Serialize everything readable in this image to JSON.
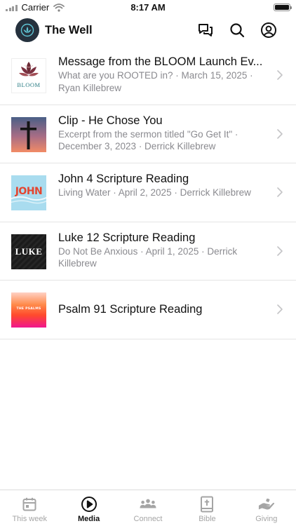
{
  "status_bar": {
    "carrier": "Carrier",
    "time": "8:17 AM"
  },
  "header": {
    "title": "The Well",
    "icons": [
      "chat-icon",
      "search-icon",
      "profile-icon"
    ]
  },
  "media_items": [
    {
      "title": "Message from the BLOOM Launch Ev...",
      "subtitle": "What are you ROOTED in? · March 15, 2025 · Ryan Killebrew",
      "thumb_text": "BLOOM"
    },
    {
      "title": "Clip - He Chose You",
      "subtitle": "Excerpt from the sermon titled \"Go Get It\" · December 3, 2023 · Derrick Killebrew",
      "thumb_text": ""
    },
    {
      "title": "John 4 Scripture Reading",
      "subtitle": "Living Water · April 2, 2025 · Derrick Killebrew",
      "thumb_text": "JOHN"
    },
    {
      "title": "Luke 12 Scripture Reading",
      "subtitle": "Do Not Be Anxious · April 1, 2025 · Derrick Killebrew",
      "thumb_text": "LUKE"
    },
    {
      "title": "Psalm 91 Scripture Reading",
      "subtitle": "",
      "thumb_text": "THE PSALMS"
    }
  ],
  "tabs": [
    {
      "label": "This week",
      "icon": "calendar-icon",
      "active": false
    },
    {
      "label": "Media",
      "icon": "play-icon",
      "active": true
    },
    {
      "label": "Connect",
      "icon": "people-icon",
      "active": false
    },
    {
      "label": "Bible",
      "icon": "bible-icon",
      "active": false
    },
    {
      "label": "Giving",
      "icon": "giving-hand-icon",
      "active": false
    }
  ],
  "colors": {
    "active_tab": "#111111",
    "inactive_tab": "#a5a5a5",
    "subtitle": "#8a8a8f",
    "divider": "#e4e4e4"
  }
}
